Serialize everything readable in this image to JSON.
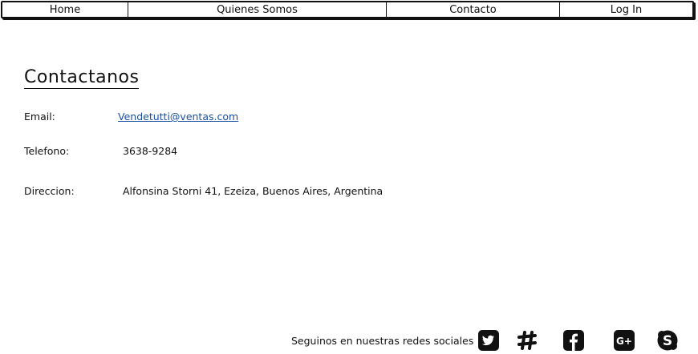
{
  "nav": {
    "home": "Home",
    "quienes": "Quienes Somos",
    "contacto": "Contacto",
    "login": "Log In"
  },
  "contact": {
    "title": "Contactanos",
    "email_label": "Email:",
    "email_value": "Vendetutti@ventas.com",
    "phone_label": "Telefono:",
    "phone_value": "3638-9284",
    "address_label": "Direccion:",
    "address_value": "Alfonsina Storni 41, Ezeiza, Buenos Aires, Argentina"
  },
  "footer": {
    "text": "Seguinos en nuestras redes sociales",
    "icons": [
      "twitter-icon",
      "slack-icon",
      "facebook-icon",
      "google-plus-icon",
      "skype-icon"
    ]
  },
  "colors": {
    "link": "#1a4fa0",
    "text": "#111111"
  }
}
